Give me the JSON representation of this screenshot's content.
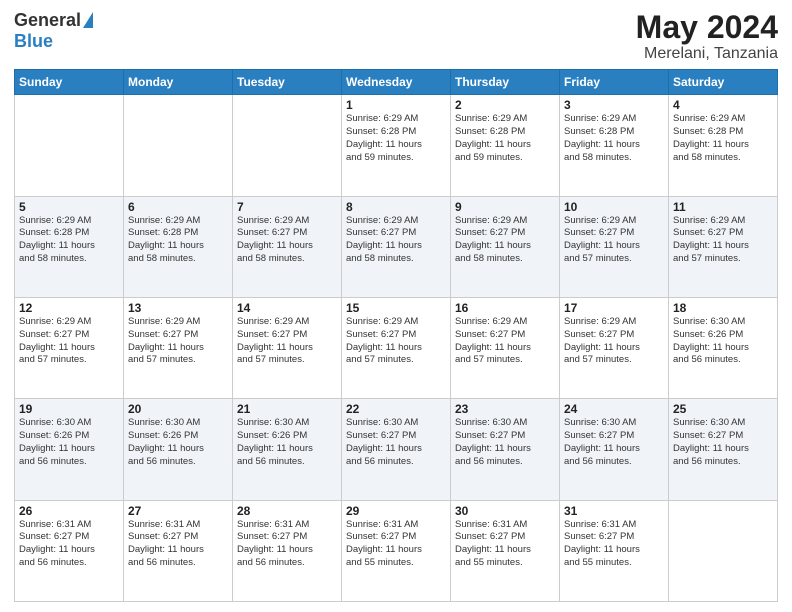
{
  "header": {
    "logo_general": "General",
    "logo_blue": "Blue",
    "title": "May 2024",
    "subtitle": "Merelani, Tanzania"
  },
  "weekdays": [
    "Sunday",
    "Monday",
    "Tuesday",
    "Wednesday",
    "Thursday",
    "Friday",
    "Saturday"
  ],
  "weeks": [
    [
      {
        "day": "",
        "info": ""
      },
      {
        "day": "",
        "info": ""
      },
      {
        "day": "",
        "info": ""
      },
      {
        "day": "1",
        "info": "Sunrise: 6:29 AM\nSunset: 6:28 PM\nDaylight: 11 hours\nand 59 minutes."
      },
      {
        "day": "2",
        "info": "Sunrise: 6:29 AM\nSunset: 6:28 PM\nDaylight: 11 hours\nand 59 minutes."
      },
      {
        "day": "3",
        "info": "Sunrise: 6:29 AM\nSunset: 6:28 PM\nDaylight: 11 hours\nand 58 minutes."
      },
      {
        "day": "4",
        "info": "Sunrise: 6:29 AM\nSunset: 6:28 PM\nDaylight: 11 hours\nand 58 minutes."
      }
    ],
    [
      {
        "day": "5",
        "info": "Sunrise: 6:29 AM\nSunset: 6:28 PM\nDaylight: 11 hours\nand 58 minutes."
      },
      {
        "day": "6",
        "info": "Sunrise: 6:29 AM\nSunset: 6:28 PM\nDaylight: 11 hours\nand 58 minutes."
      },
      {
        "day": "7",
        "info": "Sunrise: 6:29 AM\nSunset: 6:27 PM\nDaylight: 11 hours\nand 58 minutes."
      },
      {
        "day": "8",
        "info": "Sunrise: 6:29 AM\nSunset: 6:27 PM\nDaylight: 11 hours\nand 58 minutes."
      },
      {
        "day": "9",
        "info": "Sunrise: 6:29 AM\nSunset: 6:27 PM\nDaylight: 11 hours\nand 58 minutes."
      },
      {
        "day": "10",
        "info": "Sunrise: 6:29 AM\nSunset: 6:27 PM\nDaylight: 11 hours\nand 57 minutes."
      },
      {
        "day": "11",
        "info": "Sunrise: 6:29 AM\nSunset: 6:27 PM\nDaylight: 11 hours\nand 57 minutes."
      }
    ],
    [
      {
        "day": "12",
        "info": "Sunrise: 6:29 AM\nSunset: 6:27 PM\nDaylight: 11 hours\nand 57 minutes."
      },
      {
        "day": "13",
        "info": "Sunrise: 6:29 AM\nSunset: 6:27 PM\nDaylight: 11 hours\nand 57 minutes."
      },
      {
        "day": "14",
        "info": "Sunrise: 6:29 AM\nSunset: 6:27 PM\nDaylight: 11 hours\nand 57 minutes."
      },
      {
        "day": "15",
        "info": "Sunrise: 6:29 AM\nSunset: 6:27 PM\nDaylight: 11 hours\nand 57 minutes."
      },
      {
        "day": "16",
        "info": "Sunrise: 6:29 AM\nSunset: 6:27 PM\nDaylight: 11 hours\nand 57 minutes."
      },
      {
        "day": "17",
        "info": "Sunrise: 6:29 AM\nSunset: 6:27 PM\nDaylight: 11 hours\nand 57 minutes."
      },
      {
        "day": "18",
        "info": "Sunrise: 6:30 AM\nSunset: 6:26 PM\nDaylight: 11 hours\nand 56 minutes."
      }
    ],
    [
      {
        "day": "19",
        "info": "Sunrise: 6:30 AM\nSunset: 6:26 PM\nDaylight: 11 hours\nand 56 minutes."
      },
      {
        "day": "20",
        "info": "Sunrise: 6:30 AM\nSunset: 6:26 PM\nDaylight: 11 hours\nand 56 minutes."
      },
      {
        "day": "21",
        "info": "Sunrise: 6:30 AM\nSunset: 6:26 PM\nDaylight: 11 hours\nand 56 minutes."
      },
      {
        "day": "22",
        "info": "Sunrise: 6:30 AM\nSunset: 6:27 PM\nDaylight: 11 hours\nand 56 minutes."
      },
      {
        "day": "23",
        "info": "Sunrise: 6:30 AM\nSunset: 6:27 PM\nDaylight: 11 hours\nand 56 minutes."
      },
      {
        "day": "24",
        "info": "Sunrise: 6:30 AM\nSunset: 6:27 PM\nDaylight: 11 hours\nand 56 minutes."
      },
      {
        "day": "25",
        "info": "Sunrise: 6:30 AM\nSunset: 6:27 PM\nDaylight: 11 hours\nand 56 minutes."
      }
    ],
    [
      {
        "day": "26",
        "info": "Sunrise: 6:31 AM\nSunset: 6:27 PM\nDaylight: 11 hours\nand 56 minutes."
      },
      {
        "day": "27",
        "info": "Sunrise: 6:31 AM\nSunset: 6:27 PM\nDaylight: 11 hours\nand 56 minutes."
      },
      {
        "day": "28",
        "info": "Sunrise: 6:31 AM\nSunset: 6:27 PM\nDaylight: 11 hours\nand 56 minutes."
      },
      {
        "day": "29",
        "info": "Sunrise: 6:31 AM\nSunset: 6:27 PM\nDaylight: 11 hours\nand 55 minutes."
      },
      {
        "day": "30",
        "info": "Sunrise: 6:31 AM\nSunset: 6:27 PM\nDaylight: 11 hours\nand 55 minutes."
      },
      {
        "day": "31",
        "info": "Sunrise: 6:31 AM\nSunset: 6:27 PM\nDaylight: 11 hours\nand 55 minutes."
      },
      {
        "day": "",
        "info": ""
      }
    ]
  ]
}
